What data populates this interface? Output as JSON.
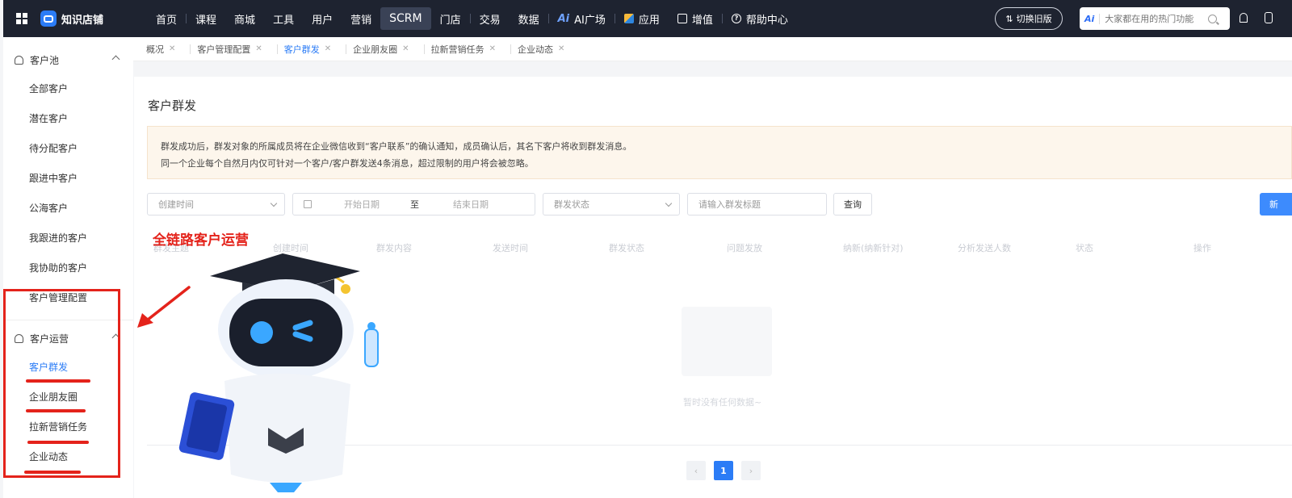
{
  "topbar": {
    "logo_text": "知识店铺",
    "nav": [
      "首页",
      "课程",
      "商城",
      "工具",
      "用户",
      "营销",
      "SCRM",
      "门店",
      "交易",
      "数据",
      "AI广场",
      "应用",
      "增值",
      "帮助中心"
    ],
    "ai_mark": "Ai",
    "switch_label": "切换旧版",
    "search_badge": "Ai",
    "search_placeholder": "大家都在用的热门功能",
    "colors": {
      "bar_bg": "#1e2330",
      "active_bg": "#3a4256"
    },
    "icons": [
      "grid-menu-icon",
      "logo-icon",
      "app-cube-icon",
      "value-added-icon",
      "help-circle-icon",
      "search-icon",
      "bell-icon"
    ]
  },
  "sidebar": {
    "group1": {
      "label": "客户池",
      "items": [
        "全部客户",
        "潜在客户",
        "待分配客户",
        "跟进中客户",
        "公海客户",
        "我跟进的客户",
        "我协助的客户",
        "客户管理配置"
      ]
    },
    "group2": {
      "label": "客户运营",
      "items": [
        "客户群发",
        "企业朋友圈",
        "拉新营销任务",
        "企业动态"
      ]
    },
    "active_color": "#2b7cf6"
  },
  "tabs": [
    "概况",
    "客户管理配置",
    "客户群发",
    "企业朋友圈",
    "拉新营销任务",
    "企业动态"
  ],
  "main": {
    "title": "客户群发",
    "notice_line1": "群发成功后，群发对象的所属成员将在企业微信收到“客户联系”的确认通知，成员确认后，其名下客户将收到群发消息。",
    "notice_line2": "同一个企业每个自然月内仅可针对一个客户/客户群发送4条消息，超过限制的用户将会被忽略。",
    "filters": {
      "time_type": "创建时间",
      "start_date": "开始日期",
      "to": "至",
      "end_date": "结束日期",
      "status": "群发状态",
      "title_placeholder": "请输入群发标题",
      "query": "查询",
      "new": "新"
    },
    "table_headers": [
      "群发主题",
      "创建时间",
      "群发内容",
      "发送时间",
      "群发状态",
      "问题发放",
      "纳新(纳新针对)",
      "分析发送人数",
      "状态",
      "操作"
    ],
    "empty_text": "暂时没有任何数据~",
    "pagination": {
      "prev": "‹",
      "current": "1",
      "next": "›"
    }
  },
  "overlay": {
    "headline": "全链路客户运营",
    "highlight_color": "#e4231b"
  }
}
